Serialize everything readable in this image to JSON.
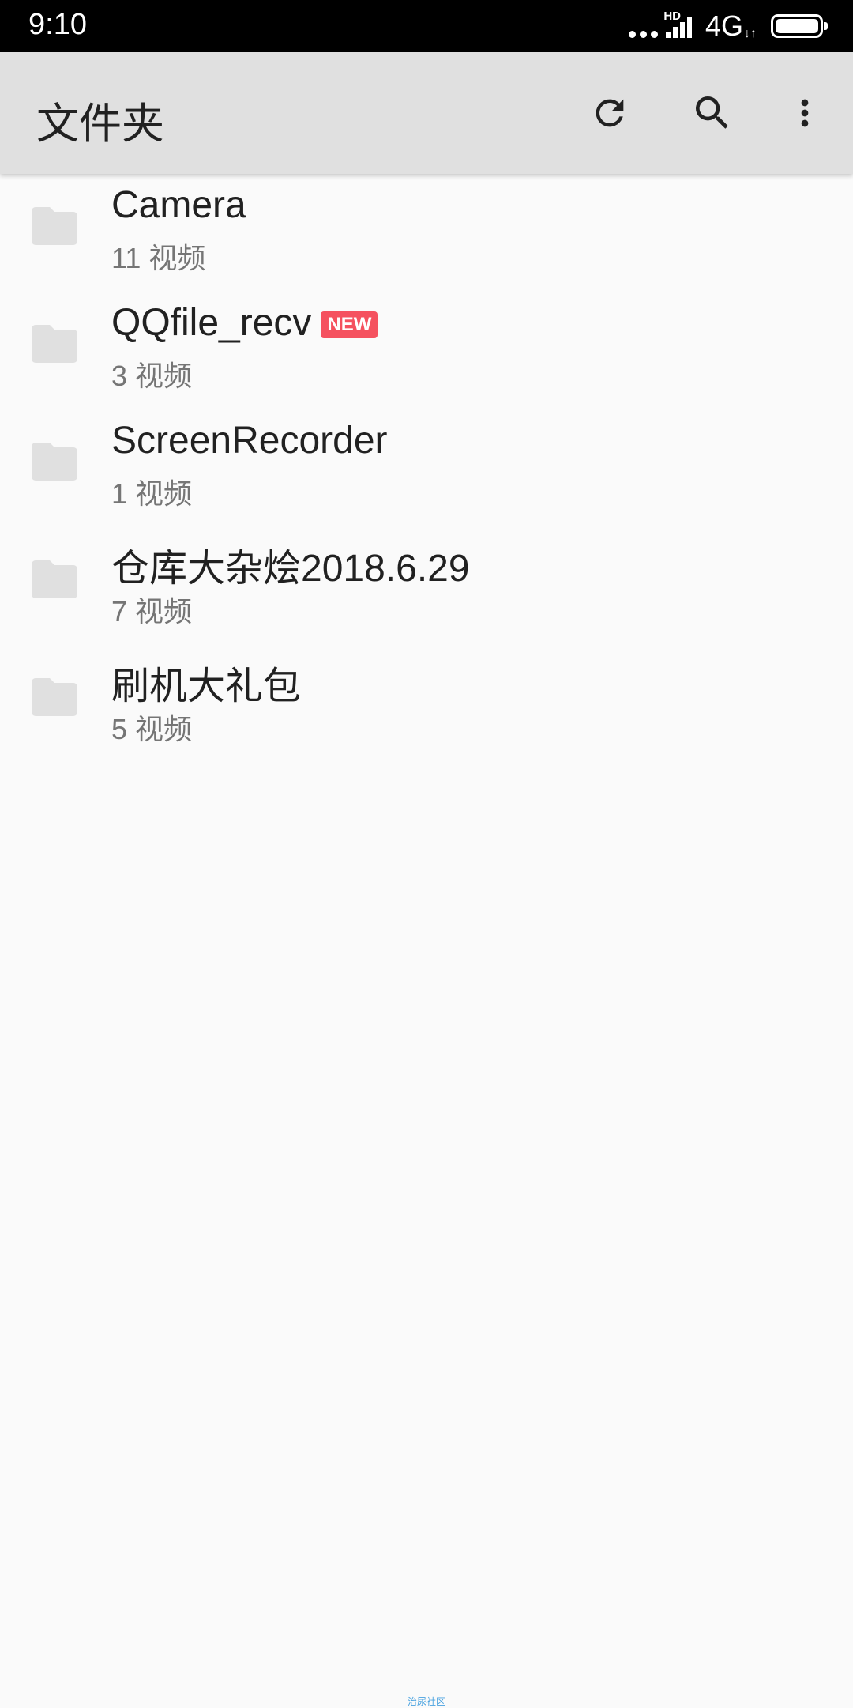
{
  "status_bar": {
    "time": "9:10",
    "hd": "HD",
    "network": "4G",
    "network_arrows": "↓↑"
  },
  "app_bar": {
    "title": "文件夹",
    "actions": [
      "refresh-icon",
      "search-icon",
      "more-vert-icon"
    ]
  },
  "folders": [
    {
      "name": "Camera",
      "count": "11 视频",
      "badge": ""
    },
    {
      "name": "QQfile_recv",
      "count": "3 视频",
      "badge": "NEW"
    },
    {
      "name": "ScreenRecorder",
      "count": "1 视频",
      "badge": ""
    },
    {
      "name": "仓库大杂烩2018.6.29",
      "count": "7 视频",
      "badge": ""
    },
    {
      "name": "刷机大礼包",
      "count": "5 视频",
      "badge": ""
    }
  ],
  "colors": {
    "app_bar": "#e0e0e0",
    "badge": "#f5515f",
    "folder_icon": "#e0e0e0"
  },
  "watermark": "治尿社区"
}
